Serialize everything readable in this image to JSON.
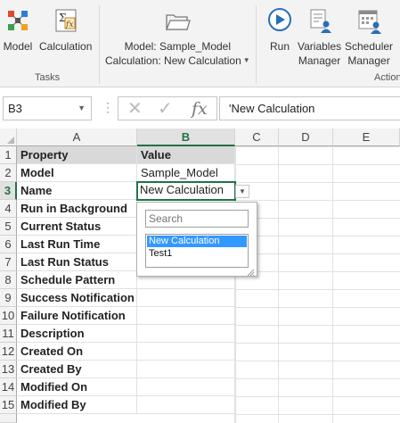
{
  "ribbon": {
    "model_label": "Model",
    "calculation_label": "Calculation",
    "tasks_group": "Tasks",
    "context_model": "Model: Sample_Model",
    "context_calc": "Calculation: New Calculation",
    "run_label": "Run",
    "variables_label_1": "Variables",
    "variables_label_2": "Manager",
    "scheduler_label_1": "Scheduler",
    "scheduler_label_2": "Manager",
    "actions_group": "Action"
  },
  "formula_bar": {
    "name_box": "B3",
    "dots": "⋮",
    "cancel_glyph": "✕",
    "enter_glyph": "✓",
    "insert_function": "fx",
    "formula": "'New Calculation"
  },
  "grid": {
    "columns": [
      "A",
      "B",
      "C",
      "D",
      "E"
    ],
    "rows": [
      "1",
      "2",
      "3",
      "4",
      "5",
      "6",
      "7",
      "8",
      "9",
      "10",
      "11",
      "12",
      "13",
      "14",
      "15"
    ],
    "col_a": [
      "Property",
      "Model",
      "Name",
      "Run in Background",
      "Current Status",
      "Last Run Time",
      "Last Run Status",
      "Schedule Pattern",
      "Success Notification",
      "Failure Notification",
      "Description",
      "Created On",
      "Created By",
      "Modified On",
      "Modified By"
    ],
    "col_b_header": "Value",
    "col_b_model": "Sample_Model",
    "col_b_name": "New Calculation"
  },
  "popup": {
    "search_placeholder": "Search",
    "items": [
      "New Calculation",
      "Test1"
    ]
  },
  "colors": {
    "excel_green": "#217346",
    "selection_blue": "#3399ff",
    "header_fill": "#d9d9d9"
  }
}
